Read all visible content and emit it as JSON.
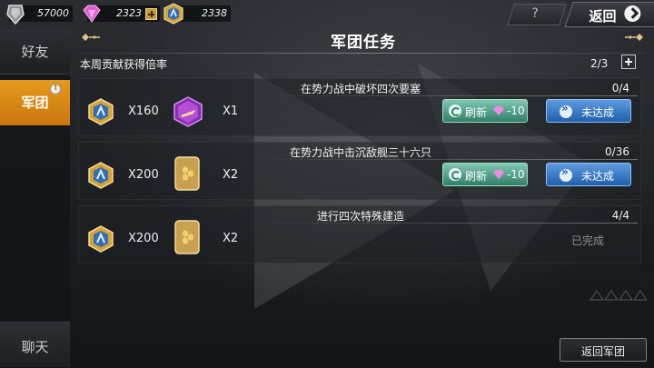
{
  "currency": [
    {
      "icon": "fuel-crystal-icon",
      "value": "57000"
    },
    {
      "icon": "pink-diamond-icon",
      "value": "2323"
    },
    {
      "icon": "legion-medal-icon",
      "value": "2338"
    }
  ],
  "header": {
    "help_label": "?",
    "back_label": "返回"
  },
  "sidebar": {
    "tabs": [
      {
        "label": "好友"
      },
      {
        "label": "军团"
      },
      {
        "label": "聊天"
      }
    ]
  },
  "panel": {
    "title": "军团任务",
    "weekly_label": "本周贡献获得倍率",
    "weekly_value": "2/3"
  },
  "tasks": [
    {
      "title": "在势力战中破坏四次要塞",
      "count": "0/4",
      "reward1_qty": "X160",
      "reward2_qty": "X1",
      "refresh_label": "刷新",
      "refresh_cost": "-10",
      "status_label": "未达成"
    },
    {
      "title": "在势力战中击沉敌舰三十六只",
      "count": "0/36",
      "reward1_qty": "X200",
      "reward2_qty": "X2",
      "refresh_label": "刷新",
      "refresh_cost": "-10",
      "status_label": "未达成"
    },
    {
      "title": "进行四次特殊建造",
      "count": "4/4",
      "reward1_qty": "X200",
      "reward2_qty": "X2",
      "status_label": "已完成"
    }
  ],
  "footer": {
    "return_legion_label": "返回军团"
  },
  "colors": {
    "active_tab": "#e49a1d",
    "refresh_button": "#3f9a7d",
    "status_button": "#2f72c4",
    "done_text": "#8c9096"
  }
}
